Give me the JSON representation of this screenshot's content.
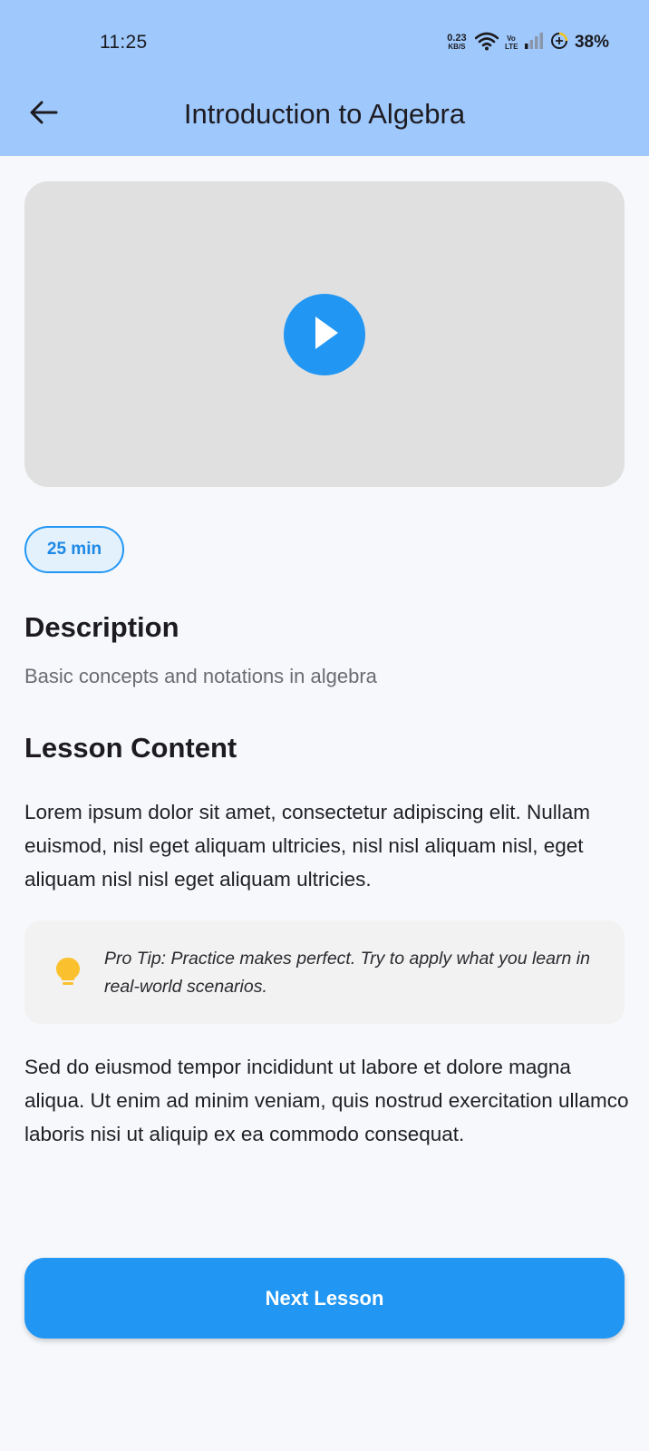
{
  "status_bar": {
    "time": "11:25",
    "network_speed_value": "0.23",
    "network_speed_unit": "KB/S",
    "volte_top": "Vo",
    "volte_bottom": "LTE",
    "battery": "38%"
  },
  "header": {
    "title": "Introduction to Algebra",
    "back_icon": "arrow-left-icon",
    "background_color": "#9fc8fd"
  },
  "video": {
    "play_icon": "play-icon",
    "accent_color": "#2196f3"
  },
  "duration": {
    "label": "25 min"
  },
  "description": {
    "heading": "Description",
    "text": "Basic concepts and notations in algebra"
  },
  "lesson": {
    "heading": "Lesson Content",
    "paragraph_1": "Lorem ipsum dolor sit amet, consectetur adipiscing elit. Nullam euismod, nisl eget aliquam ultricies, nisl nisl aliquam nisl, eget aliquam nisl nisl eget aliquam ultricies.",
    "tip": "Pro Tip: Practice makes perfect. Try to apply what you learn in real-world scenarios.",
    "tip_icon": "lightbulb-icon",
    "tip_icon_color": "#fbc02d",
    "paragraph_2": "Sed do eiusmod tempor incididunt ut labore et dolore magna aliqua. Ut enim ad minim veniam, quis nostrud exercitation ullamco laboris nisi ut aliquip ex ea commodo consequat."
  },
  "actions": {
    "next_label": "Next Lesson"
  }
}
